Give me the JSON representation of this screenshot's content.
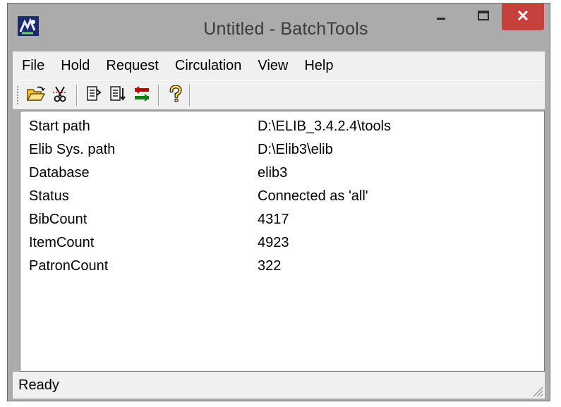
{
  "window": {
    "title": "Untitled - BatchTools",
    "app_icon": "batchtools-app-icon",
    "controls": [
      "minimize-icon",
      "maximize-icon",
      "close-icon"
    ]
  },
  "menu": {
    "items": [
      "File",
      "Hold",
      "Request",
      "Circulation",
      "View",
      "Help"
    ]
  },
  "toolbar": {
    "buttons": [
      "open-folder-icon",
      "cut-icon",
      "import-icon",
      "export-icon",
      "transfer-arrows-icon",
      "help-icon"
    ]
  },
  "info": {
    "rows": [
      {
        "label": "Start path",
        "value": "D:\\ELIB_3.4.2.4\\tools"
      },
      {
        "label": "Elib Sys. path",
        "value": "D:\\Elib3\\elib"
      },
      {
        "label": "Database",
        "value": "elib3"
      },
      {
        "label": "Status",
        "value": "Connected as 'all'"
      },
      {
        "label": "BibCount",
        "value": "4317"
      },
      {
        "label": "ItemCount",
        "value": "4923"
      },
      {
        "label": "PatronCount",
        "value": "322"
      }
    ]
  },
  "statusbar": {
    "text": "Ready"
  },
  "colors": {
    "titlebar": "#ababab",
    "close_button": "#c7413c",
    "chrome": "#f0f0f0",
    "content_bg": "#ffffff"
  }
}
